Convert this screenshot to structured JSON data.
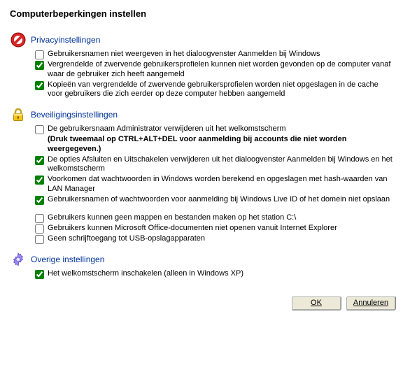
{
  "title": "Computerbeperkingen instellen",
  "sections": {
    "privacy": {
      "title": "Privacyinstellingen",
      "items": [
        {
          "label": "Gebruikersnamen niet weergeven in het dialoogvenster Aanmelden bij Windows",
          "checked": false
        },
        {
          "label": "Vergrendelde of zwervende gebruikersprofielen kunnen niet worden gevonden op de computer vanaf waar de gebruiker zich heeft aangemeld",
          "checked": true
        },
        {
          "label": "Kopieën van vergrendelde of zwervende gebruikersprofielen worden niet opgeslagen in de cache voor gebruikers die zich eerder op deze computer hebben aangemeld",
          "checked": true
        }
      ]
    },
    "security": {
      "title": "Beveiligingsinstellingen",
      "group1": [
        {
          "label": "De gebruikersnaam Administrator verwijderen uit het welkomstscherm",
          "sub": "(Druk tweemaal op CTRL+ALT+DEL voor aanmelding bij accounts die niet worden weergegeven.)",
          "checked": false
        },
        {
          "label": "De opties Afsluiten en Uitschakelen verwijderen uit het dialoogvenster Aanmelden bij Windows en het welkomstscherm",
          "checked": true
        },
        {
          "label": "Voorkomen dat wachtwoorden in Windows worden berekend en opgeslagen met hash-waarden van LAN Manager",
          "checked": true
        },
        {
          "label": "Gebruikersnamen of wachtwoorden voor aanmelding bij Windows Live ID of het domein niet opslaan",
          "checked": true
        }
      ],
      "group2": [
        {
          "label": "Gebruikers kunnen geen mappen en bestanden maken op het station C:\\",
          "checked": false
        },
        {
          "label": "Gebruikers kunnen Microsoft Office-documenten niet openen vanuit Internet Explorer",
          "checked": false
        },
        {
          "label": "Geen schrijftoegang tot USB-opslagapparaten",
          "checked": false
        }
      ]
    },
    "other": {
      "title": "Overige instellingen",
      "items": [
        {
          "label": "Het welkomstscherm inschakelen (alleen in Windows XP)",
          "checked": true
        }
      ]
    }
  },
  "buttons": {
    "ok": "OK",
    "cancel": "Annuleren"
  }
}
